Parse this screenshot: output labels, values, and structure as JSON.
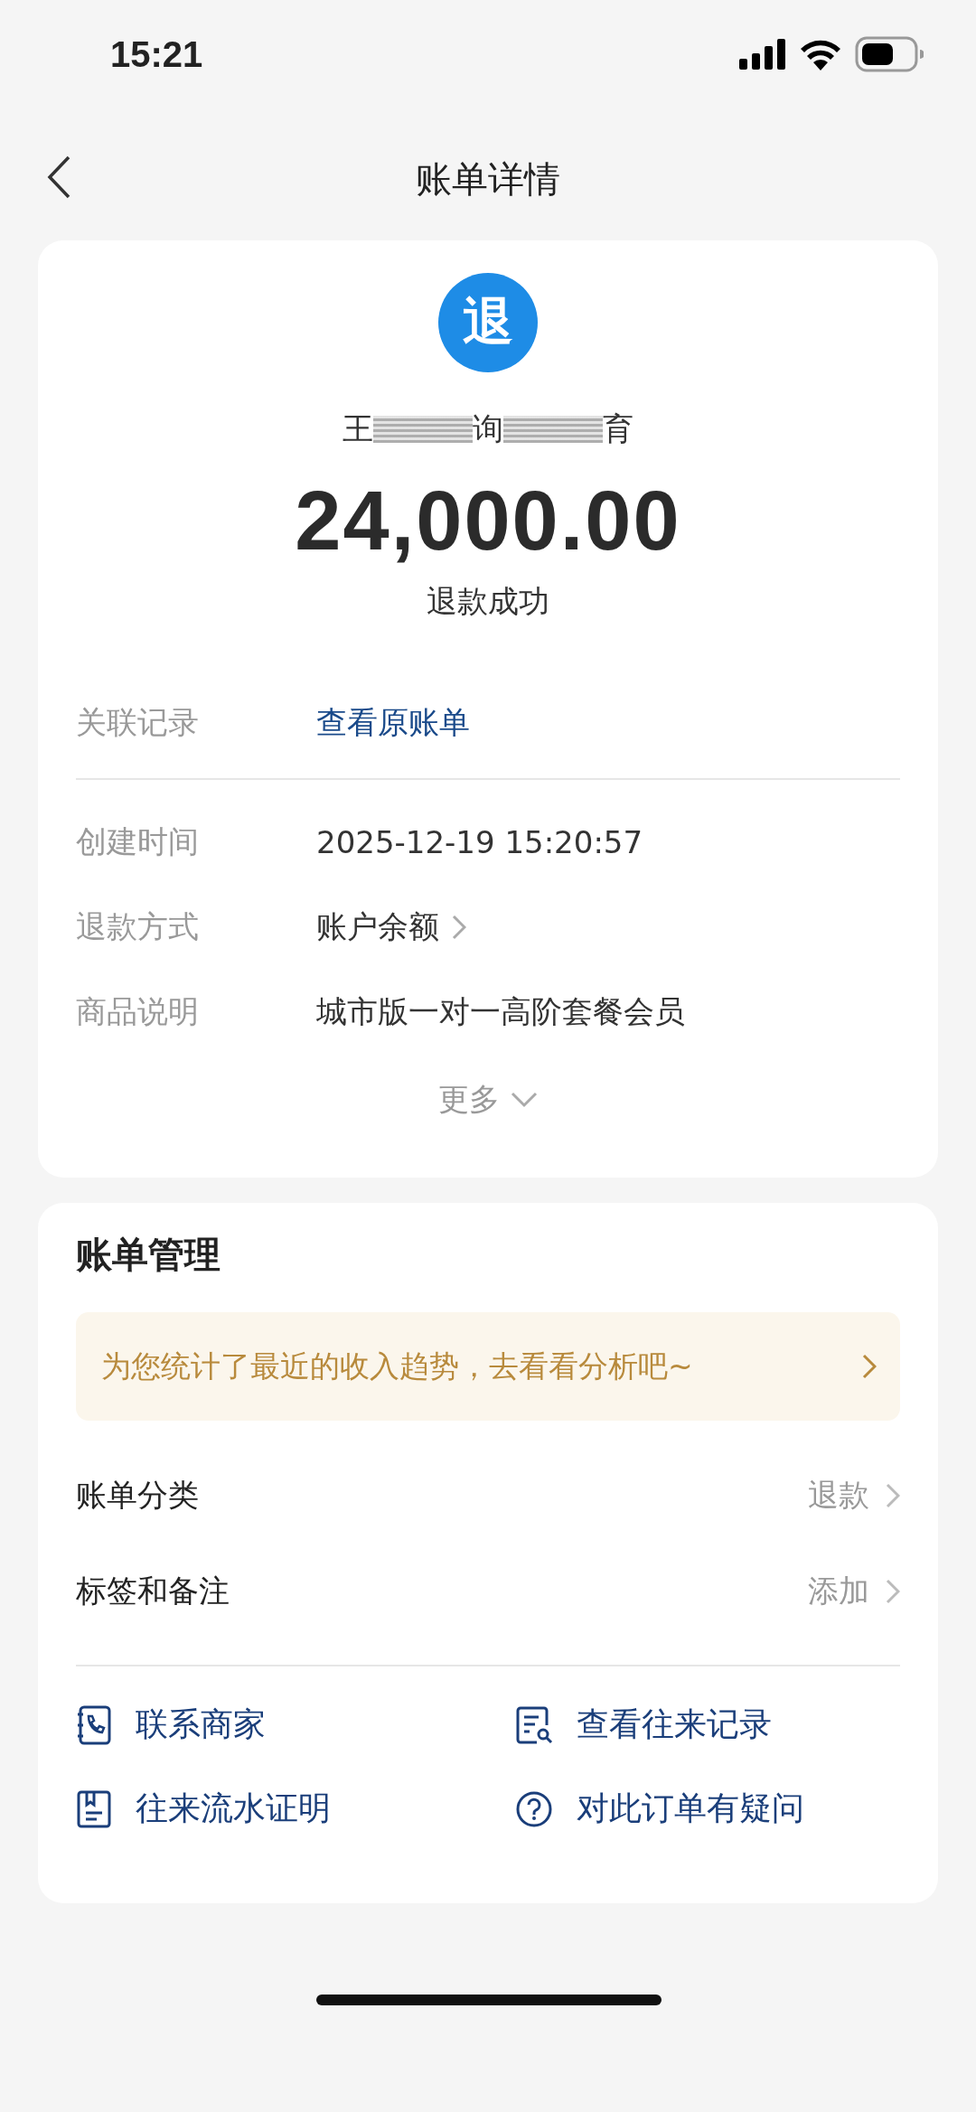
{
  "status_bar": {
    "time": "15:21"
  },
  "nav": {
    "title": "账单详情"
  },
  "summary": {
    "badge": "退",
    "merchant": [
      {
        "kind": "text",
        "text": "王"
      },
      {
        "kind": "redacted"
      },
      {
        "kind": "text",
        "text": "询"
      },
      {
        "kind": "redacted"
      },
      {
        "kind": "text",
        "text": "育"
      }
    ],
    "amount": "24,000.00",
    "status": "退款成功"
  },
  "related": {
    "label": "关联记录",
    "link": "查看原账单"
  },
  "details": [
    {
      "label": "创建时间",
      "value": "2025-12-19 15:20:57",
      "chevron": false
    },
    {
      "label": "退款方式",
      "value": "账户余额",
      "chevron": true
    },
    {
      "label": "商品说明",
      "value": "城市版一对一高阶套餐会员",
      "chevron": false
    }
  ],
  "more": "更多",
  "management": {
    "title": "账单管理",
    "banner": "为您统计了最近的收入趋势，去看看分析吧~",
    "rows": [
      {
        "label": "账单分类",
        "value": "退款"
      },
      {
        "label": "标签和备注",
        "value": "添加"
      }
    ],
    "actions": [
      {
        "kind": "phone",
        "label": "联系商家"
      },
      {
        "kind": "records",
        "label": "查看往来记录"
      },
      {
        "kind": "proof",
        "label": "往来流水证明"
      },
      {
        "kind": "question",
        "label": "对此订单有疑问"
      }
    ]
  }
}
